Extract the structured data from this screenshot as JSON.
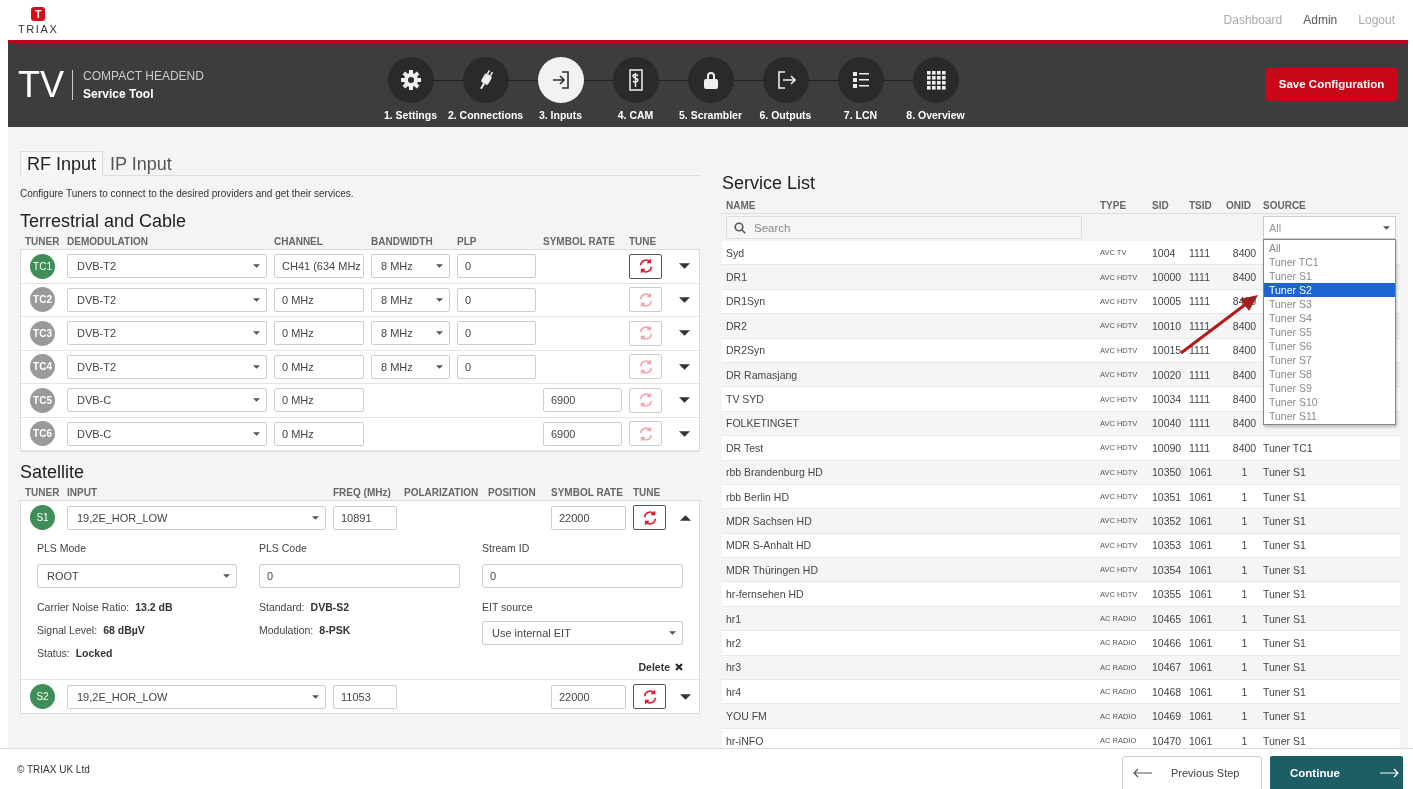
{
  "brand": {
    "mark": "T",
    "name": "TRIAX"
  },
  "top_nav": [
    {
      "label": "Dashboard",
      "selected": false
    },
    {
      "label": "Admin",
      "selected": true
    },
    {
      "label": "Logout",
      "selected": false
    }
  ],
  "header": {
    "product": "TV",
    "title": "COMPACT HEADEND",
    "subtitle": "Service Tool"
  },
  "steps": [
    {
      "label": "1. Settings",
      "selected": false
    },
    {
      "label": "2. Connections",
      "selected": false
    },
    {
      "label": "3. Inputs",
      "selected": true
    },
    {
      "label": "4. CAM",
      "selected": false
    },
    {
      "label": "5. Scrambler",
      "selected": false
    },
    {
      "label": "6. Outputs",
      "selected": false
    },
    {
      "label": "7. LCN",
      "selected": false
    },
    {
      "label": "8. Overview",
      "selected": false
    }
  ],
  "save_button": "Save Configuration",
  "input_tabs": [
    {
      "label": "RF Input",
      "selected": true
    },
    {
      "label": "IP Input",
      "selected": false
    }
  ],
  "description": "Configure Tuners to connect to the desired providers and get their services.",
  "terrestrial": {
    "title": "Terrestrial and Cable",
    "columns": [
      "TUNER",
      "DEMODULATION",
      "CHANNEL",
      "BANDWIDTH",
      "PLP",
      "SYMBOL RATE",
      "TUNE"
    ],
    "tuners": [
      {
        "id": "TC1",
        "active": true,
        "demodulation": "DVB-T2",
        "channel": "CH41 (634 MHz",
        "bandwidth": "8 MHz",
        "plp": "0",
        "expanded": false
      },
      {
        "id": "TC2",
        "active": false,
        "demodulation": "DVB-T2",
        "channel": "0 MHz",
        "bandwidth": "8 MHz",
        "plp": "0",
        "expanded": false
      },
      {
        "id": "TC3",
        "active": false,
        "demodulation": "DVB-T2",
        "channel": "0 MHz",
        "bandwidth": "8 MHz",
        "plp": "0",
        "expanded": false
      },
      {
        "id": "TC4",
        "active": false,
        "demodulation": "DVB-T2",
        "channel": "0 MHz",
        "bandwidth": "8 MHz",
        "plp": "0",
        "expanded": false
      },
      {
        "id": "TC5",
        "active": false,
        "demodulation": "DVB-C",
        "channel": "0 MHz",
        "symbol_rate": "6900",
        "expanded": false
      },
      {
        "id": "TC6",
        "active": false,
        "demodulation": "DVB-C",
        "channel": "0 MHz",
        "symbol_rate": "6900",
        "expanded": false
      }
    ]
  },
  "satellite": {
    "title": "Satellite",
    "columns": [
      "TUNER",
      "INPUT",
      "FREQ (MHz)",
      "POLARIZATION",
      "POSITION",
      "SYMBOL RATE",
      "TUNE"
    ],
    "tuners": [
      {
        "id": "S1",
        "active": true,
        "input": "19,2E_HOR_LOW",
        "freq": "10891",
        "symbol_rate": "22000",
        "expanded": true,
        "details": {
          "pls_mode_label": "PLS Mode",
          "pls_mode": "ROOT",
          "pls_code_label": "PLS Code",
          "pls_code": "0",
          "stream_id_label": "Stream ID",
          "stream_id": "0",
          "left_stats": [
            {
              "label": "Carrier Noise Ratio:",
              "value": "13.2 dB"
            },
            {
              "label": "Signal Level:",
              "value": "68 dBµV"
            },
            {
              "label": "Status:",
              "value": "Locked"
            }
          ],
          "middle_stats": [
            {
              "label": "Standard:",
              "value": "DVB-S2"
            },
            {
              "label": "Modulation:",
              "value": "8-PSK"
            }
          ],
          "eit_label": "EIT source",
          "eit_value": "Use internal EIT",
          "delete": "Delete"
        }
      },
      {
        "id": "S2",
        "active": true,
        "input": "19,2E_HOR_LOW",
        "freq": "11053",
        "symbol_rate": "22000",
        "expanded": false
      }
    ]
  },
  "service_list": {
    "title": "Service List",
    "columns": [
      "NAME",
      "TYPE",
      "SID",
      "TSID",
      "ONID",
      "SOURCE"
    ],
    "search_placeholder": "Search",
    "source_filter": "All",
    "source_options": [
      {
        "label": "All",
        "selected": false
      },
      {
        "label": "Tuner TC1",
        "selected": false
      },
      {
        "label": "Tuner S1",
        "selected": false
      },
      {
        "label": "Tuner S2",
        "selected": true
      },
      {
        "label": "Tuner S3",
        "selected": false
      },
      {
        "label": "Tuner S4",
        "selected": false
      },
      {
        "label": "Tuner S5",
        "selected": false
      },
      {
        "label": "Tuner S6",
        "selected": false
      },
      {
        "label": "Tuner S7",
        "selected": false
      },
      {
        "label": "Tuner S8",
        "selected": false
      },
      {
        "label": "Tuner S9",
        "selected": false
      },
      {
        "label": "Tuner S10",
        "selected": false
      },
      {
        "label": "Tuner S11",
        "selected": false
      }
    ],
    "rows": [
      {
        "name": "Syd",
        "type": "AVC TV",
        "sid": "1004",
        "tsid": "1111",
        "onid": "8400"
      },
      {
        "name": "DR1",
        "type": "AVC HDTV",
        "sid": "10000",
        "tsid": "1111",
        "onid": "8400"
      },
      {
        "name": "DR1Syn",
        "type": "AVC HDTV",
        "sid": "10005",
        "tsid": "1111",
        "onid": "8400"
      },
      {
        "name": "DR2",
        "type": "AVC HDTV",
        "sid": "10010",
        "tsid": "1111",
        "onid": "8400"
      },
      {
        "name": "DR2Syn",
        "type": "AVC HDTV",
        "sid": "10015",
        "tsid": "1111",
        "onid": "8400"
      },
      {
        "name": "DR Ramasjang",
        "type": "AVC HDTV",
        "sid": "10020",
        "tsid": "1111",
        "onid": "8400"
      },
      {
        "name": "TV SYD",
        "type": "AVC HDTV",
        "sid": "10034",
        "tsid": "1111",
        "onid": "8400"
      },
      {
        "name": "FOLKETINGET",
        "type": "AVC HDTV",
        "sid": "10040",
        "tsid": "1111",
        "onid": "8400"
      },
      {
        "name": "DR Test",
        "type": "AVC HDTV",
        "sid": "10090",
        "tsid": "1111",
        "onid": "8400",
        "source": "Tuner TC1"
      },
      {
        "name": "rbb Brandenburg HD",
        "type": "AVC HDTV",
        "sid": "10350",
        "tsid": "1061",
        "onid": "1",
        "source": "Tuner S1"
      },
      {
        "name": "rbb Berlin HD",
        "type": "AVC HDTV",
        "sid": "10351",
        "tsid": "1061",
        "onid": "1",
        "source": "Tuner S1"
      },
      {
        "name": "MDR Sachsen HD",
        "type": "AVC HDTV",
        "sid": "10352",
        "tsid": "1061",
        "onid": "1",
        "source": "Tuner S1"
      },
      {
        "name": "MDR S-Anhalt HD",
        "type": "AVC HDTV",
        "sid": "10353",
        "tsid": "1061",
        "onid": "1",
        "source": "Tuner S1"
      },
      {
        "name": "MDR Thüringen HD",
        "type": "AVC HDTV",
        "sid": "10354",
        "tsid": "1061",
        "onid": "1",
        "source": "Tuner S1"
      },
      {
        "name": "hr-fernsehen HD",
        "type": "AVC HDTV",
        "sid": "10355",
        "tsid": "1061",
        "onid": "1",
        "source": "Tuner S1"
      },
      {
        "name": "hr1",
        "type": "AC RADIO",
        "sid": "10465",
        "tsid": "1061",
        "onid": "1",
        "source": "Tuner S1"
      },
      {
        "name": "hr2",
        "type": "AC RADIO",
        "sid": "10466",
        "tsid": "1061",
        "onid": "1",
        "source": "Tuner S1"
      },
      {
        "name": "hr3",
        "type": "AC RADIO",
        "sid": "10467",
        "tsid": "1061",
        "onid": "1",
        "source": "Tuner S1"
      },
      {
        "name": "hr4",
        "type": "AC RADIO",
        "sid": "10468",
        "tsid": "1061",
        "onid": "1",
        "source": "Tuner S1"
      },
      {
        "name": "YOU FM",
        "type": "AC RADIO",
        "sid": "10469",
        "tsid": "1061",
        "onid": "1",
        "source": "Tuner S1"
      },
      {
        "name": "hr-iNFO",
        "type": "AC RADIO",
        "sid": "10470",
        "tsid": "1061",
        "onid": "1",
        "source": "Tuner S1"
      }
    ]
  },
  "footer": {
    "copyright": "© TRIAX UK Ltd",
    "previous": "Previous Step",
    "continue": "Continue"
  }
}
